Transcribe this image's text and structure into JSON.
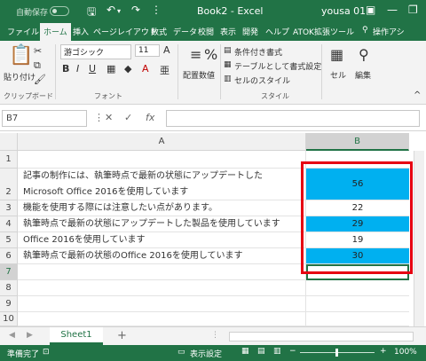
{
  "titlebar": {
    "autosave_label": "自動保存",
    "toggle_state": "オフ",
    "doc_title": "Book2  -  Excel",
    "user": "yousa 01"
  },
  "ribbon_tabs": [
    "ファイル",
    "ホーム",
    "挿入",
    "ページレイアウト",
    "数式",
    "データ",
    "校閲",
    "表示",
    "開発",
    "ヘルプ",
    "ATOK拡張ツール",
    "操作アシ"
  ],
  "ribbon": {
    "paste": "貼り付け",
    "clipboard": "クリップボード",
    "font_name": "游ゴシック",
    "font_size": "11",
    "font_group": "フォント",
    "bold": "B",
    "italic": "I",
    "underline": "U",
    "grow_font": "A",
    "shrink_font": "A",
    "font_color": "A",
    "align": "配置",
    "number": "数値",
    "cond_format": "条件付き書式",
    "table_format": "テーブルとして書式設定",
    "cell_style": "セルのスタイル",
    "style_group": "スタイル",
    "cells": "セル",
    "edit": "編集"
  },
  "formula_bar": {
    "name_box": "B7",
    "fx": "fx",
    "cancel": "✕",
    "enter": "✓",
    "value": ""
  },
  "columns": [
    "A",
    "B"
  ],
  "rows": [
    {
      "num": "1",
      "a": "",
      "b": "",
      "highlight": false
    },
    {
      "num": "2",
      "a": "記事の制作には、執筆時点で最新の状態にアップデートした",
      "a2": "Microsoft Office 2016を使用しています",
      "b": "56",
      "highlight": true
    },
    {
      "num": "3",
      "a": "機能を使用する際には注意したい点があります。",
      "b": "22",
      "highlight": false
    },
    {
      "num": "4",
      "a": "執筆時点で最新の状態にアップデートした製品を使用しています",
      "b": "29",
      "highlight": true
    },
    {
      "num": "5",
      "a": "Office 2016を使用しています",
      "b": "19",
      "highlight": false
    },
    {
      "num": "6",
      "a": "執筆時点で最新の状態のOffice 2016を使用しています",
      "b": "30",
      "highlight": true
    },
    {
      "num": "7",
      "a": "",
      "b": "",
      "highlight": false
    },
    {
      "num": "8",
      "a": "",
      "b": "",
      "highlight": false
    },
    {
      "num": "9",
      "a": "",
      "b": "",
      "highlight": false
    },
    {
      "num": "10",
      "a": "",
      "b": "",
      "highlight": false
    }
  ],
  "sheet_tabs": [
    "Sheet1"
  ],
  "add_sheet": "+",
  "statusbar": {
    "ready": "準備完了",
    "display_settings": "表示設定",
    "zoom_minus": "−",
    "zoom_plus": "+",
    "zoom_level": "100%"
  },
  "colors": {
    "accent": "#217346",
    "highlight": "#00b0f0",
    "annotation": "#e60012"
  }
}
